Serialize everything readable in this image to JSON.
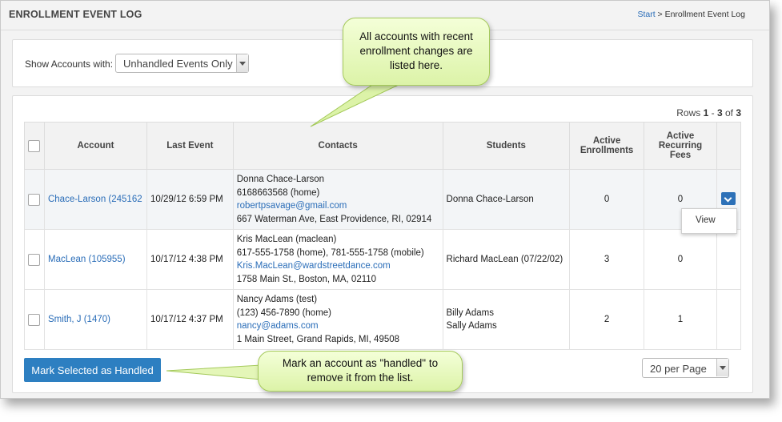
{
  "header": {
    "title": "ENROLLMENT EVENT LOG",
    "breadcrumb_start": "Start",
    "breadcrumb_sep": " > ",
    "breadcrumb_current": "Enrollment Event Log"
  },
  "filter": {
    "label": "Show Accounts with:",
    "selected": "Unhandled Events Only"
  },
  "rows_info": {
    "prefix": "Rows ",
    "start": "1",
    "sep": " - ",
    "end": "3",
    "of": " of ",
    "total": "3"
  },
  "table": {
    "headers": [
      "Account",
      "Last Event",
      "Contacts",
      "Students",
      "Active Enrollments",
      "Active Recurring Fees"
    ],
    "rows": [
      {
        "account": "Chace-Larson (245162",
        "last_event": "10/29/12 6:59 PM",
        "contact_name": "Donna Chace-Larson",
        "contact_phone": "6168663568 (home)",
        "contact_email": "robertpsavage@gmail.com",
        "contact_address": "667 Waterman Ave, East Providence, RI, 02914",
        "students": [
          "Donna Chace-Larson"
        ],
        "active_enrollments": "0",
        "active_recurring_fees": "0"
      },
      {
        "account": "MacLean (105955)",
        "last_event": "10/17/12 4:38 PM",
        "contact_name": "Kris MacLean (maclean)",
        "contact_phone": "617-555-1758 (home), 781-555-1758 (mobile)",
        "contact_email": "Kris.MacLean@wardstreetdance.com",
        "contact_address": "1758 Main St., Boston, MA, 02110",
        "students": [
          "Richard MacLean (07/22/02)"
        ],
        "active_enrollments": "3",
        "active_recurring_fees": "0"
      },
      {
        "account": "Smith, J (1470)",
        "last_event": "10/17/12 4:37 PM",
        "contact_name": "Nancy Adams (test)",
        "contact_phone": "(123) 456-7890 (home)",
        "contact_email": "nancy@adams.com",
        "contact_address": "1 Main Street, Grand Rapids, MI, 49508",
        "students": [
          "Billy Adams",
          "Sally Adams"
        ],
        "active_enrollments": "2",
        "active_recurring_fees": "1"
      }
    ]
  },
  "row_menu": {
    "view_label": "View"
  },
  "footer": {
    "mark_button": "Mark Selected as Handled",
    "per_page": "20 per Page"
  },
  "callouts": {
    "list_note": "All accounts with recent enrollment changes are listed here.",
    "handled_note": "Mark an account as \"handled\" to remove it from the list."
  },
  "colors": {
    "accent": "#2d7fc1",
    "link": "#2a6db8",
    "callout": "#dcf3a8"
  },
  "icons": {
    "row_action": "chevron-down-icon",
    "select_arrow": "caret-down-icon"
  }
}
